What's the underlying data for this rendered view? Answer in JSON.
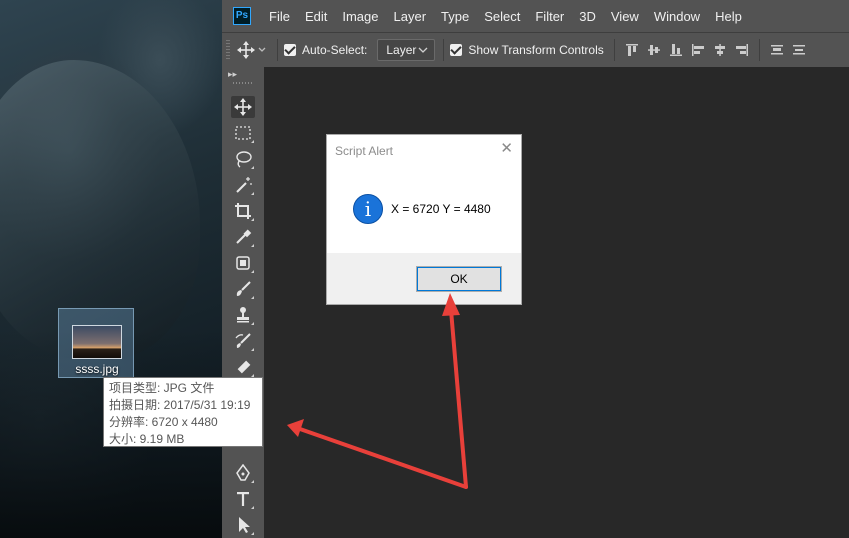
{
  "desktop": {
    "file_icon": {
      "name": "ssss.jpg",
      "icon": "image-file-icon"
    },
    "tooltip": [
      "项目类型: JPG 文件",
      "拍摄日期: 2017/5/31 19:19",
      "分辨率: 6720 x 4480",
      "大小: 9.19 MB"
    ]
  },
  "photoshop": {
    "logo": "Ps",
    "menu": [
      "File",
      "Edit",
      "Image",
      "Layer",
      "Type",
      "Select",
      "Filter",
      "3D",
      "View",
      "Window",
      "Help"
    ],
    "options_bar": {
      "auto_select_label": "Auto-Select:",
      "auto_select_checked": true,
      "auto_select_target": "Layer",
      "show_transform_label": "Show Transform Controls",
      "show_transform_checked": true
    },
    "tools": [
      "move-tool-icon",
      "marquee-tool-icon",
      "lasso-tool-icon",
      "magic-wand-tool-icon",
      "crop-tool-icon",
      "eyedropper-tool-icon",
      "healing-brush-tool-icon",
      "brush-tool-icon",
      "clone-stamp-tool-icon",
      "history-brush-tool-icon",
      "eraser-tool-icon",
      "pen-tool-icon",
      "type-tool-icon",
      "path-selection-tool-icon"
    ]
  },
  "dialog": {
    "title": "Script Alert",
    "message": "X = 6720 Y = 4480",
    "ok_label": "OK",
    "icon": "info-icon"
  },
  "colors": {
    "ps_chrome": "#535353",
    "ps_canvas": "#282828",
    "annotation_arrow": "#e8403a",
    "info_blue": "#1a73d9"
  }
}
